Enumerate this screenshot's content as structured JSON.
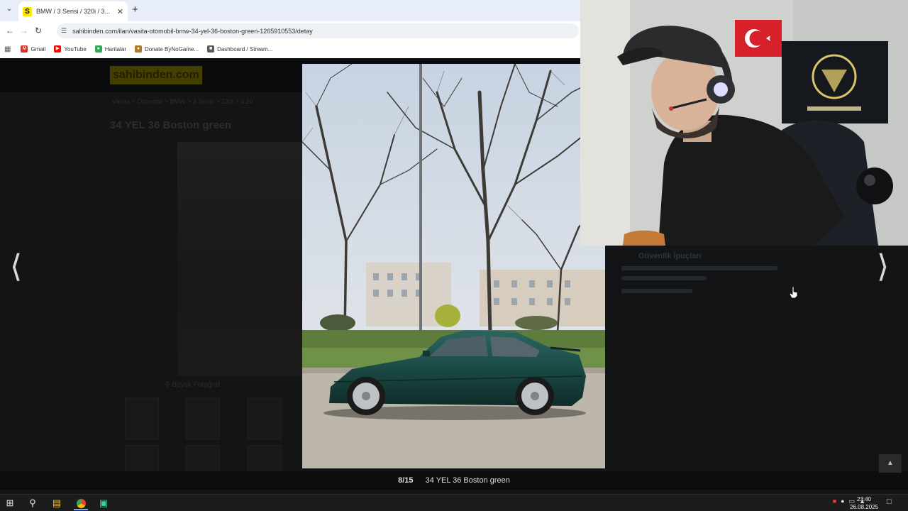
{
  "browser": {
    "tab_title": "BMW / 3 Serisi / 320i / 3...",
    "tab_favicon": "S",
    "url": "sahibinden.com/ilan/vasita-otomobil-bmw-34-yel-36-boston-green-1265910553/detay",
    "bookmarks": [
      {
        "label": "Gmail",
        "icon": "gmail-icon",
        "color": "#d93025"
      },
      {
        "label": "YouTube",
        "icon": "youtube-icon",
        "color": "#ff0000"
      },
      {
        "label": "Haritalar",
        "icon": "maps-icon",
        "color": "#34a853"
      },
      {
        "label": "Donate ByNoGame...",
        "icon": "donate-icon",
        "color": "#b07a20"
      },
      {
        "label": "Dashboard / Stream...",
        "icon": "dashboard-icon",
        "color": "#5b5b5b"
      }
    ]
  },
  "page": {
    "logo": "sahibinden.com",
    "breadcrumb": "Vasıta  >  Otomobil  >  BMW  >  3 Serisi  >  320i  >  3.20",
    "listing_title": "34 YEL 36 Boston green",
    "photo_link": "Büyük Fotoğraf",
    "security_title": "Güvenlik İpuçları"
  },
  "gallery": {
    "counter": "8/15",
    "caption": "34 YEL 36 Boston green"
  },
  "taskbar": {
    "time": "23:40",
    "date": "26.08.2025"
  },
  "colors": {
    "car": "#1b4a45",
    "brand_yellow": "#ffe800"
  }
}
